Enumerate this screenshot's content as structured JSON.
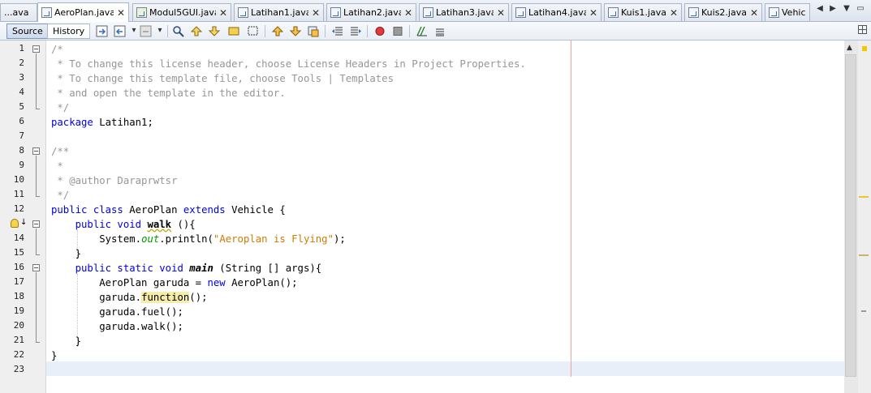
{
  "tabs": [
    {
      "label": "...ava",
      "closable": false
    },
    {
      "label": "AeroPlan.java",
      "active": true
    },
    {
      "label": "Modul5GUI.java"
    },
    {
      "label": "Latihan1.java"
    },
    {
      "label": "Latihan2.java"
    },
    {
      "label": "Latihan3.java"
    },
    {
      "label": "Latihan4.java"
    },
    {
      "label": "Kuis1.java"
    },
    {
      "label": "Kuis2.java"
    },
    {
      "label": "Vehic..."
    }
  ],
  "tab_close_symbol": "✕",
  "tab_nav": {
    "left": "◀",
    "right": "▶",
    "menu": "▼",
    "restore": "▭"
  },
  "toolbar": {
    "source_label": "Source",
    "history_label": "History"
  },
  "line_numbers": [
    "1",
    "2",
    "3",
    "4",
    "5",
    "6",
    "7",
    "8",
    "9",
    "10",
    "11",
    "12",
    "13",
    "14",
    "15",
    "16",
    "17",
    "18",
    "19",
    "20",
    "21",
    "22",
    "23"
  ],
  "code": {
    "l1": "/*",
    "l2": " * To change this license header, choose License Headers in Project Properties.",
    "l3": " * To change this template file, choose Tools | Templates",
    "l4": " * and open the template in the editor.",
    "l5": " */",
    "l6_kw": "package",
    "l6_rest": " Latihan1;",
    "l8": "/**",
    "l9": " *",
    "l10": " * @author Daraprwtsr",
    "l11": " */",
    "l12_kw1": "public class",
    "l12_name": " AeroPlan ",
    "l12_kw2": "extends",
    "l12_rest": " Vehicle {",
    "l13_kw": "    public void",
    "l13_sp": " ",
    "l13_name": "walk",
    "l13_rest": " (){",
    "l14_a": "        System.",
    "l14_field": "out",
    "l14_b": ".println(",
    "l14_str": "\"Aeroplan is Flying\"",
    "l14_c": ");",
    "l15": "    }",
    "l16_kw": "    public static void",
    "l16_sp": " ",
    "l16_name": "main",
    "l16_rest": " (String [] args){",
    "l17_a": "        AeroPlan garuda = ",
    "l17_kw": "new",
    "l17_b": " AeroPlan();",
    "l18_a": "        garuda.",
    "l18_hl": "function",
    "l18_b": "();",
    "l19": "        garuda.fuel();",
    "l20": "        garuda.walk();",
    "l21": "    }",
    "l22": "}",
    "l23": ""
  },
  "icons": {
    "hint": "lightbulb-warning-icon",
    "breakpoint": "breakpoint-icon"
  },
  "colors": {
    "keyword": "#0000e6",
    "comment": "#969696",
    "string": "#ce7b00",
    "field": "#009900",
    "current_line": "#e9eff8",
    "highlight": "#f4eea8"
  }
}
